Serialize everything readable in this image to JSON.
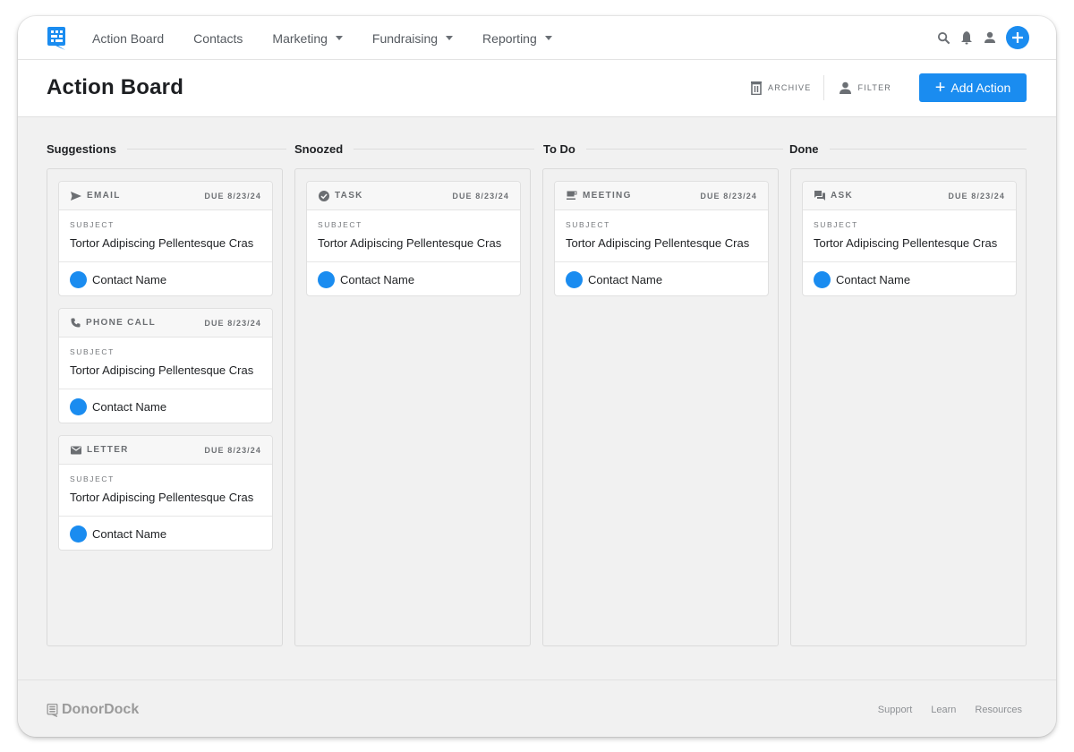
{
  "nav": {
    "items": [
      {
        "label": "Action Board",
        "dropdown": false
      },
      {
        "label": "Contacts",
        "dropdown": false
      },
      {
        "label": "Marketing",
        "dropdown": true
      },
      {
        "label": "Fundraising",
        "dropdown": true
      },
      {
        "label": "Reporting",
        "dropdown": true
      }
    ],
    "icons": [
      "search-icon",
      "bell-icon",
      "user-icon",
      "plus-circle-icon"
    ]
  },
  "header": {
    "title": "Action Board",
    "archive_label": "ARCHIVE",
    "filter_label": "FILTER",
    "add_label": "Add Action"
  },
  "colors": {
    "accent": "#1a8cf0",
    "background": "#f1f1f1"
  },
  "columns": [
    {
      "title": "Suggestions",
      "cards": [
        {
          "type": "EMAIL",
          "icon": "send-icon",
          "due": "DUE 8/23/24",
          "subject_label": "SUBJECT",
          "subject": "Tortor Adipiscing Pellentesque Cras",
          "contact": "Contact Name"
        },
        {
          "type": "PHONE CALL",
          "icon": "phone-icon",
          "due": "DUE 8/23/24",
          "subject_label": "SUBJECT",
          "subject": "Tortor Adipiscing Pellentesque Cras",
          "contact": "Contact Name"
        },
        {
          "type": "LETTER",
          "icon": "mail-icon",
          "due": "DUE 8/23/24",
          "subject_label": "SUBJECT",
          "subject": "Tortor Adipiscing Pellentesque Cras",
          "contact": "Contact Name"
        }
      ]
    },
    {
      "title": "Snoozed",
      "cards": [
        {
          "type": "TASK",
          "icon": "check-circle-icon",
          "due": "DUE 8/23/24",
          "subject_label": "SUBJECT",
          "subject": "Tortor Adipiscing Pellentesque Cras",
          "contact": "Contact Name"
        }
      ]
    },
    {
      "title": "To Do",
      "cards": [
        {
          "type": "MEETING",
          "icon": "coffee-icon",
          "due": "DUE 8/23/24",
          "subject_label": "SUBJECT",
          "subject": "Tortor Adipiscing Pellentesque Cras",
          "contact": "Contact Name"
        }
      ]
    },
    {
      "title": "Done",
      "cards": [
        {
          "type": "ASK",
          "icon": "chat-icon",
          "due": "DUE 8/23/24",
          "subject_label": "SUBJECT",
          "subject": "Tortor Adipiscing Pellentesque Cras",
          "contact": "Contact Name"
        }
      ]
    }
  ],
  "footer": {
    "brand": "DonorDock",
    "links": [
      "Support",
      "Learn",
      "Resources"
    ]
  }
}
